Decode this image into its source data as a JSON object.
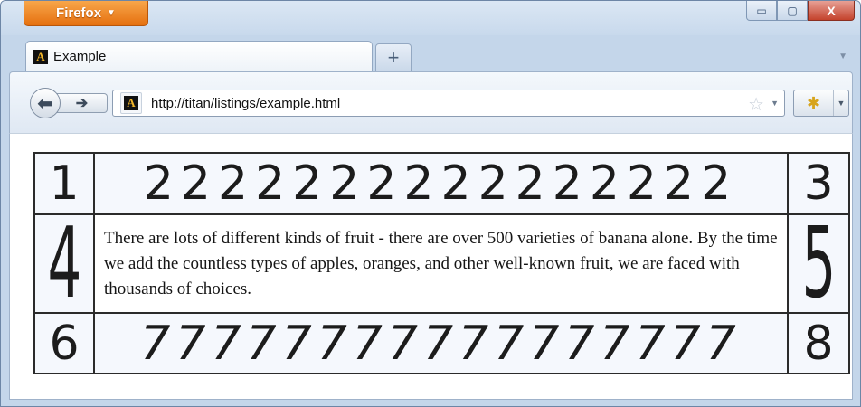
{
  "browser": {
    "menu_button_label": "Firefox",
    "tab_title": "Example",
    "new_tab_glyph": "+",
    "url": "http://titan/listings/example.html",
    "site_icon_letter": "A",
    "window_controls": {
      "minimize": "▭",
      "maximize": "▢",
      "close": "X"
    }
  },
  "table": {
    "row1": [
      "1",
      "2222222222222222",
      "3"
    ],
    "row2": [
      "4",
      "There are lots of different kinds of fruit - there are over 500 varieties of banana alone. By the time we add the countless types of apples, oranges, and other well-known fruit, we are faced with thousands of choices.",
      "5"
    ],
    "row3": [
      "6",
      "77777777777777777",
      "8"
    ]
  },
  "icons": [
    "firefox-menu-icon",
    "back-arrow-icon",
    "forward-arrow-icon",
    "site-icon",
    "bookmark-star-icon",
    "addon-icon",
    "dropdown-caret-icon"
  ]
}
